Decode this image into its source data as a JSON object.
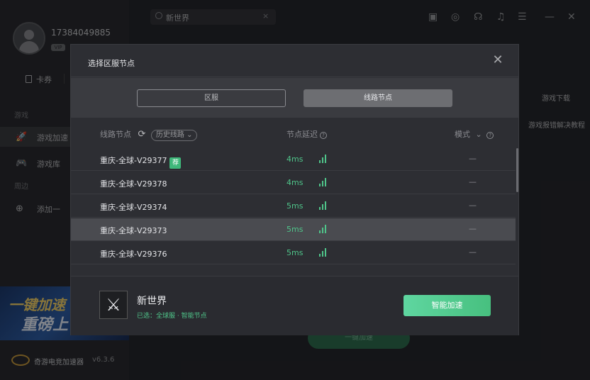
{
  "sidebar": {
    "phone": "17384049885",
    "vip": "VIP",
    "card_label": "卡券",
    "section_games": "游戏",
    "nav": [
      {
        "label": "游戏加速",
        "icon": "rocket-icon"
      },
      {
        "label": "游戏库",
        "icon": "gamepad-icon"
      }
    ],
    "section_nearby": "周边",
    "nearby_item": "添加一",
    "promo_line1": "一键加速",
    "promo_line2": "重磅上",
    "brand_name": "奇游电竞加速器",
    "version": "v6.3.6"
  },
  "topbar": {
    "search_value": "新世界",
    "right_links": [
      "游戏下载",
      "游戏报错解决教程"
    ]
  },
  "modal": {
    "title": "选择区服节点",
    "tabs": [
      "区服",
      "线路节点"
    ],
    "columns": {
      "route": "线路节点",
      "history": "历史线路",
      "latency": "节点延迟",
      "mode": "模式"
    },
    "rows": [
      {
        "name": "重庆-全球-V29377",
        "recommended": "荐",
        "latency": "4ms",
        "mode": "—"
      },
      {
        "name": "重庆-全球-V29378",
        "recommended": null,
        "latency": "4ms",
        "mode": "—"
      },
      {
        "name": "重庆-全球-V29374",
        "recommended": null,
        "latency": "5ms",
        "mode": "—"
      },
      {
        "name": "重庆-全球-V29373",
        "recommended": null,
        "latency": "5ms",
        "mode": "—"
      },
      {
        "name": "重庆-全球-V29376",
        "recommended": null,
        "latency": "5ms",
        "mode": "—"
      }
    ],
    "game_name": "新世界",
    "selected_text": "已选：全球服 · 智能节点",
    "accel_button": "智能加速"
  },
  "under_button": "一键加速",
  "colors": {
    "accent_green": "#4fc58a",
    "button_green": "#5fd6a0",
    "recommend_badge": "#3fb87a"
  }
}
